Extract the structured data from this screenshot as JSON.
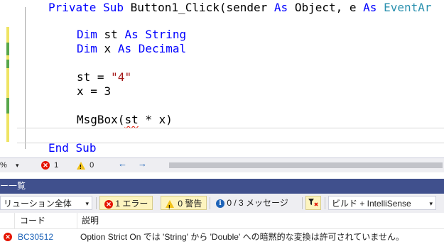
{
  "editor": {
    "lines": [
      {
        "kind": "sub",
        "kw1": "Private",
        "kw2": "Sub",
        "name": "Button1_Click(sender",
        "kw3": "As",
        "type1": "Object",
        "mid": ", e",
        "kw4": "As",
        "type2": "EventAr"
      },
      {
        "kind": "dim",
        "kw": "Dim",
        "rest1": "st",
        "kw2": "As",
        "kw3": "String"
      },
      {
        "kind": "dim",
        "kw": "Dim",
        "rest1": "x",
        "kw2": "As",
        "kw3": "Decimal"
      },
      {
        "kind": "assign_str",
        "lhs": "st = ",
        "str": "\"4\""
      },
      {
        "kind": "assign",
        "text": "x = 3"
      },
      {
        "kind": "msgbox",
        "fn": "MsgBox(",
        "err": "st",
        "rest": " * x)"
      },
      {
        "kind": "end",
        "kw1": "End",
        "kw2": "Sub"
      }
    ]
  },
  "editor_status": {
    "zoom_suffix": "%",
    "zoom_arrow": "▾",
    "errors": "1",
    "warnings": "0",
    "nav_back": "←",
    "nav_fwd": "→"
  },
  "error_panel": {
    "title": "ー一覧",
    "scope_filter": "リューション全体",
    "scope_arrow": "▾",
    "errors_button": "1 エラー",
    "warnings_button": "0 警告",
    "messages_button": "0 / 3 メッセージ",
    "build_filter": "ビルド + IntelliSense",
    "build_arrow": "▾",
    "columns": {
      "code": "コード",
      "description": "説明"
    },
    "rows": [
      {
        "code": "BC30512",
        "description": "Option Strict On では 'String' から 'Double' への暗黙的な変換は許可されていません。"
      }
    ]
  },
  "colors": {
    "keyword": "#0000ff",
    "string": "#a31515",
    "type": "#2b91af",
    "error": "#e51400",
    "panel_title_bg": "#40508d",
    "link": "#1e63b8"
  },
  "icons": [
    "error-icon",
    "warning-icon",
    "info-icon",
    "filter-icon",
    "chevron-down-icon",
    "arrow-left-icon",
    "arrow-right-icon"
  ]
}
